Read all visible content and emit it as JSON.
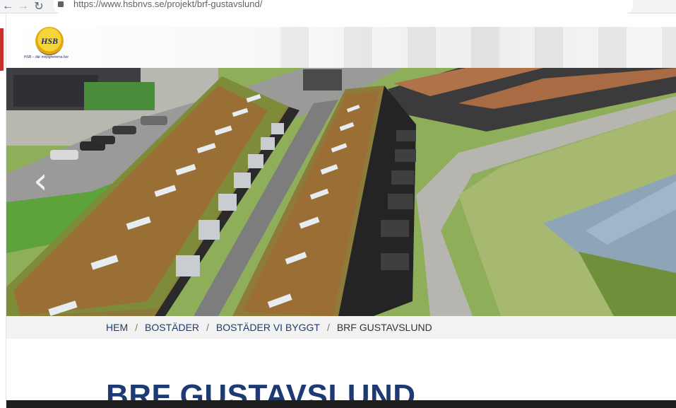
{
  "browser": {
    "url": "https://www.hsbnvs.se/projekt/brf-gustavslund/",
    "back_icon": "arrow-left-icon",
    "forward_icon": "arrow-right-icon",
    "reload_icon": "reload-icon",
    "lock_icon": "lock-icon"
  },
  "header": {
    "logo_text": "HSB",
    "tagline": "HSB – där möjligheterna bor"
  },
  "hero": {
    "prev_icon": "chevron-left-icon"
  },
  "breadcrumb": {
    "items": [
      "HEM",
      "BOSTÄDER",
      "BOSTÄDER VI BYGGT"
    ],
    "current": "BRF GUSTAVSLUND",
    "separator": "/"
  },
  "page": {
    "title": "BRF GUSTAVSLUND"
  },
  "colors": {
    "brand_blue": "#1d3a73",
    "brand_yellow": "#f6d53a",
    "breadcrumb_bg": "#f2f2f2"
  }
}
